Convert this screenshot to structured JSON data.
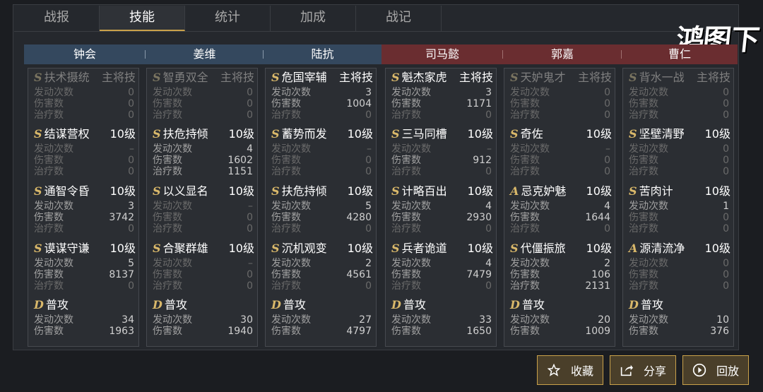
{
  "tabs": [
    "战报",
    "技能",
    "统计",
    "加成",
    "战记"
  ],
  "active_tab": "技能",
  "logo_text": "鸿图之下",
  "generals": [
    {
      "name": "钟会",
      "side": "blue",
      "skills": [
        {
          "grade": "S",
          "name": "扶术摄统",
          "level": "主将技",
          "dim": true,
          "stats": [
            [
              "发动次数",
              "0"
            ],
            [
              "伤害数",
              "0"
            ],
            [
              "治疗数",
              "0"
            ]
          ]
        },
        {
          "grade": "S",
          "name": "结谋营权",
          "level": "10级",
          "dim": false,
          "stats": [
            [
              "发动次数",
              "–"
            ],
            [
              "伤害数",
              "0"
            ],
            [
              "治疗数",
              "0"
            ]
          ]
        },
        {
          "grade": "S",
          "name": "通智令昏",
          "level": "10级",
          "dim": false,
          "stats": [
            [
              "发动次数",
              "3"
            ],
            [
              "伤害数",
              "3742"
            ],
            [
              "治疗数",
              "0"
            ]
          ]
        },
        {
          "grade": "S",
          "name": "谟谋守谦",
          "level": "10级",
          "dim": false,
          "stats": [
            [
              "发动次数",
              "5"
            ],
            [
              "伤害数",
              "8137"
            ],
            [
              "治疗数",
              "0"
            ]
          ]
        },
        {
          "grade": "D",
          "name": "普攻",
          "level": "",
          "dim": false,
          "stats": [
            [
              "发动次数",
              "34"
            ],
            [
              "伤害数",
              "1963"
            ]
          ]
        }
      ]
    },
    {
      "name": "姜维",
      "side": "blue",
      "skills": [
        {
          "grade": "S",
          "name": "智勇双全",
          "level": "主将技",
          "dim": true,
          "stats": [
            [
              "发动次数",
              "0"
            ],
            [
              "伤害数",
              "0"
            ],
            [
              "治疗数",
              "0"
            ]
          ]
        },
        {
          "grade": "S",
          "name": "扶危持倾",
          "level": "10级",
          "dim": false,
          "stats": [
            [
              "发动次数",
              "4"
            ],
            [
              "伤害数",
              "1602"
            ],
            [
              "治疗数",
              "1151"
            ]
          ]
        },
        {
          "grade": "S",
          "name": "以义显名",
          "level": "10级",
          "dim": false,
          "stats": [
            [
              "发动次数",
              "–"
            ],
            [
              "伤害数",
              "0"
            ],
            [
              "治疗数",
              "0"
            ]
          ]
        },
        {
          "grade": "S",
          "name": "合聚群雄",
          "level": "10级",
          "dim": false,
          "stats": [
            [
              "发动次数",
              "–"
            ],
            [
              "伤害数",
              "0"
            ],
            [
              "治疗数",
              "0"
            ]
          ]
        },
        {
          "grade": "D",
          "name": "普攻",
          "level": "",
          "dim": false,
          "stats": [
            [
              "发动次数",
              "30"
            ],
            [
              "伤害数",
              "1940"
            ]
          ]
        }
      ]
    },
    {
      "name": "陆抗",
      "side": "blue",
      "skills": [
        {
          "grade": "S",
          "name": "危国宰辅",
          "level": "主将技",
          "dim": false,
          "stats": [
            [
              "发动次数",
              "3"
            ],
            [
              "伤害数",
              "1004"
            ],
            [
              "治疗数",
              "0"
            ]
          ]
        },
        {
          "grade": "S",
          "name": "蓄势而发",
          "level": "10级",
          "dim": false,
          "stats": [
            [
              "发动次数",
              "–"
            ],
            [
              "伤害数",
              "0"
            ],
            [
              "治疗数",
              "0"
            ]
          ]
        },
        {
          "grade": "S",
          "name": "扶危持倾",
          "level": "10级",
          "dim": false,
          "stats": [
            [
              "发动次数",
              "5"
            ],
            [
              "伤害数",
              "4280"
            ],
            [
              "治疗数",
              "0"
            ]
          ]
        },
        {
          "grade": "S",
          "name": "沉机观变",
          "level": "10级",
          "dim": false,
          "stats": [
            [
              "发动次数",
              "2"
            ],
            [
              "伤害数",
              "4561"
            ],
            [
              "治疗数",
              "0"
            ]
          ]
        },
        {
          "grade": "D",
          "name": "普攻",
          "level": "",
          "dim": false,
          "stats": [
            [
              "发动次数",
              "27"
            ],
            [
              "伤害数",
              "4797"
            ]
          ]
        }
      ]
    },
    {
      "name": "司马懿",
      "side": "red",
      "skills": [
        {
          "grade": "S",
          "name": "魁杰家虎",
          "level": "主将技",
          "dim": false,
          "stats": [
            [
              "发动次数",
              "3"
            ],
            [
              "伤害数",
              "1171"
            ],
            [
              "治疗数",
              "0"
            ]
          ]
        },
        {
          "grade": "S",
          "name": "三马同槽",
          "level": "10级",
          "dim": false,
          "stats": [
            [
              "发动次数",
              "–"
            ],
            [
              "伤害数",
              "912"
            ],
            [
              "治疗数",
              "0"
            ]
          ]
        },
        {
          "grade": "S",
          "name": "计略百出",
          "level": "10级",
          "dim": false,
          "stats": [
            [
              "发动次数",
              "4"
            ],
            [
              "伤害数",
              "2930"
            ],
            [
              "治疗数",
              "0"
            ]
          ]
        },
        {
          "grade": "S",
          "name": "兵者诡道",
          "level": "10级",
          "dim": false,
          "stats": [
            [
              "发动次数",
              "4"
            ],
            [
              "伤害数",
              "7479"
            ],
            [
              "治疗数",
              "0"
            ]
          ]
        },
        {
          "grade": "D",
          "name": "普攻",
          "level": "",
          "dim": false,
          "stats": [
            [
              "发动次数",
              "33"
            ],
            [
              "伤害数",
              "1650"
            ]
          ]
        }
      ]
    },
    {
      "name": "郭嘉",
      "side": "red",
      "skills": [
        {
          "grade": "S",
          "name": "天妒鬼才",
          "level": "主将技",
          "dim": true,
          "stats": [
            [
              "发动次数",
              "0"
            ],
            [
              "伤害数",
              "0"
            ],
            [
              "治疗数",
              "0"
            ]
          ]
        },
        {
          "grade": "S",
          "name": "奇佐",
          "level": "10级",
          "dim": false,
          "stats": [
            [
              "发动次数",
              "–"
            ],
            [
              "伤害数",
              "0"
            ],
            [
              "治疗数",
              "0"
            ]
          ]
        },
        {
          "grade": "A",
          "name": "忌克妒魅",
          "level": "10级",
          "dim": false,
          "stats": [
            [
              "发动次数",
              "4"
            ],
            [
              "伤害数",
              "1644"
            ],
            [
              "治疗数",
              "0"
            ]
          ]
        },
        {
          "grade": "S",
          "name": "代僵振旅",
          "level": "10级",
          "dim": false,
          "stats": [
            [
              "发动次数",
              "2"
            ],
            [
              "伤害数",
              "106"
            ],
            [
              "治疗数",
              "2131"
            ]
          ]
        },
        {
          "grade": "D",
          "name": "普攻",
          "level": "",
          "dim": false,
          "stats": [
            [
              "发动次数",
              "20"
            ],
            [
              "伤害数",
              "1009"
            ]
          ]
        }
      ]
    },
    {
      "name": "曹仁",
      "side": "red",
      "skills": [
        {
          "grade": "S",
          "name": "背水一战",
          "level": "主将技",
          "dim": true,
          "stats": [
            [
              "发动次数",
              "0"
            ],
            [
              "伤害数",
              "0"
            ],
            [
              "治疗数",
              "0"
            ]
          ]
        },
        {
          "grade": "S",
          "name": "坚壁清野",
          "level": "10级",
          "dim": false,
          "stats": [
            [
              "发动次数",
              "0"
            ],
            [
              "伤害数",
              "0"
            ],
            [
              "治疗数",
              "0"
            ]
          ]
        },
        {
          "grade": "S",
          "name": "苦肉计",
          "level": "10级",
          "dim": false,
          "stats": [
            [
              "发动次数",
              "1"
            ],
            [
              "伤害数",
              "0"
            ],
            [
              "治疗数",
              "0"
            ]
          ]
        },
        {
          "grade": "A",
          "name": "源清流净",
          "level": "10级",
          "dim": false,
          "stats": [
            [
              "发动次数",
              "0"
            ],
            [
              "伤害数",
              "0"
            ],
            [
              "治疗数",
              "0"
            ]
          ]
        },
        {
          "grade": "D",
          "name": "普攻",
          "level": "",
          "dim": false,
          "stats": [
            [
              "发动次数",
              "10"
            ],
            [
              "伤害数",
              "376"
            ]
          ]
        }
      ]
    }
  ],
  "buttons": {
    "favorite": "收藏",
    "share": "分享",
    "replay": "回放"
  }
}
